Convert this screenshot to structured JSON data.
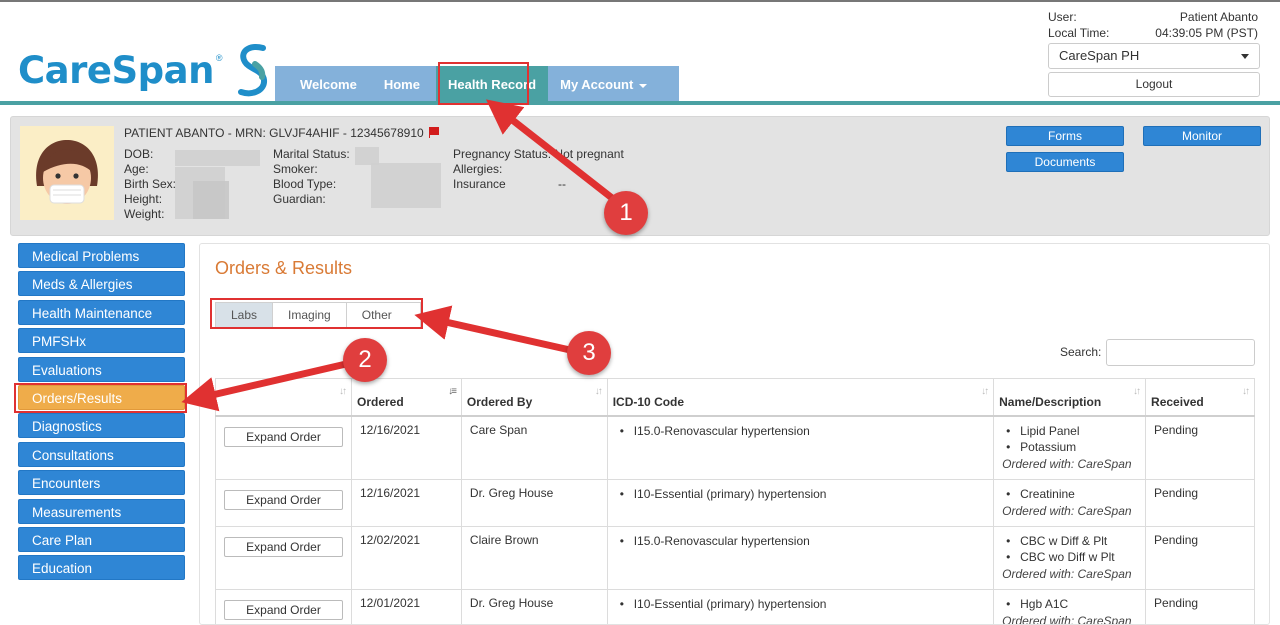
{
  "header": {
    "logo_text": "CareSpan",
    "logo_reg": "®",
    "nav": [
      {
        "label": "Welcome"
      },
      {
        "label": "Home"
      },
      {
        "label": "Health Record"
      },
      {
        "label": "My Account"
      }
    ],
    "user_label": "User:",
    "user_value": "Patient Abanto",
    "time_label": "Local Time:",
    "time_value": "04:39:05 PM (PST)",
    "org_select": "CareSpan PH",
    "logout": "Logout"
  },
  "patient": {
    "title": "PATIENT ABANTO - MRN: GLVJF4AHIF - 12345678910",
    "col1": [
      "DOB:",
      "Age:",
      "Birth Sex:",
      "Height:",
      "Weight:"
    ],
    "col2": [
      "Marital Status:",
      "Smoker:",
      "Blood Type:",
      "Guardian:"
    ],
    "col3_labels": [
      "Pregnancy Status:",
      "Allergies:",
      "Insurance"
    ],
    "pregnancy_value": "Not pregnant",
    "insurance_value": "--",
    "buttons": {
      "forms": "Forms",
      "documents": "Documents",
      "monitor": "Monitor"
    }
  },
  "sidebar": {
    "items": [
      {
        "label": "Medical Problems"
      },
      {
        "label": "Meds & Allergies"
      },
      {
        "label": "Health Maintenance"
      },
      {
        "label": "PMFSHx"
      },
      {
        "label": "Evaluations"
      },
      {
        "label": "Orders/Results"
      },
      {
        "label": "Diagnostics"
      },
      {
        "label": "Consultations"
      },
      {
        "label": "Encounters"
      },
      {
        "label": "Measurements"
      },
      {
        "label": "Care Plan"
      },
      {
        "label": "Education"
      }
    ]
  },
  "main": {
    "title": "Orders & Results",
    "tabs": [
      {
        "label": "Labs"
      },
      {
        "label": "Imaging"
      },
      {
        "label": "Other"
      }
    ],
    "search_label": "Search:",
    "columns": [
      "",
      "Ordered",
      "Ordered By",
      "ICD-10 Code",
      "Name/Description",
      "Received"
    ],
    "expand_label": "Expand Order",
    "rows": [
      {
        "date": "12/16/2021",
        "by": "Care Span",
        "icd": "I15.0-Renovascular hypertension",
        "items": [
          "Lipid Panel",
          "Potassium"
        ],
        "with": "Ordered with: CareSpan",
        "received": "Pending"
      },
      {
        "date": "12/16/2021",
        "by": "Dr. Greg House",
        "icd": "I10-Essential (primary) hypertension",
        "items": [
          "Creatinine"
        ],
        "with": "Ordered with: CareSpan",
        "received": "Pending"
      },
      {
        "date": "12/02/2021",
        "by": "Claire Brown",
        "icd": "I15.0-Renovascular hypertension",
        "items": [
          "CBC w Diff & Plt",
          "CBC wo Diff w Plt"
        ],
        "with": "Ordered with: CareSpan",
        "received": "Pending"
      },
      {
        "date": "12/01/2021",
        "by": "Dr. Greg House",
        "icd": "I10-Essential (primary) hypertension",
        "items": [
          "Hgb A1C"
        ],
        "with": "Ordered with: CareSpan",
        "received": "Pending"
      }
    ]
  },
  "annotations": {
    "one": "1",
    "two": "2",
    "three": "3"
  },
  "colors": {
    "brand_blue": "#1f8ec9",
    "teal": "#4aa1a3",
    "nav_blue": "#84b1da",
    "side_blue": "#2f86d5",
    "active_orange": "#efac4a",
    "title_orange": "#d97a35",
    "annotation_red": "#e03131"
  }
}
